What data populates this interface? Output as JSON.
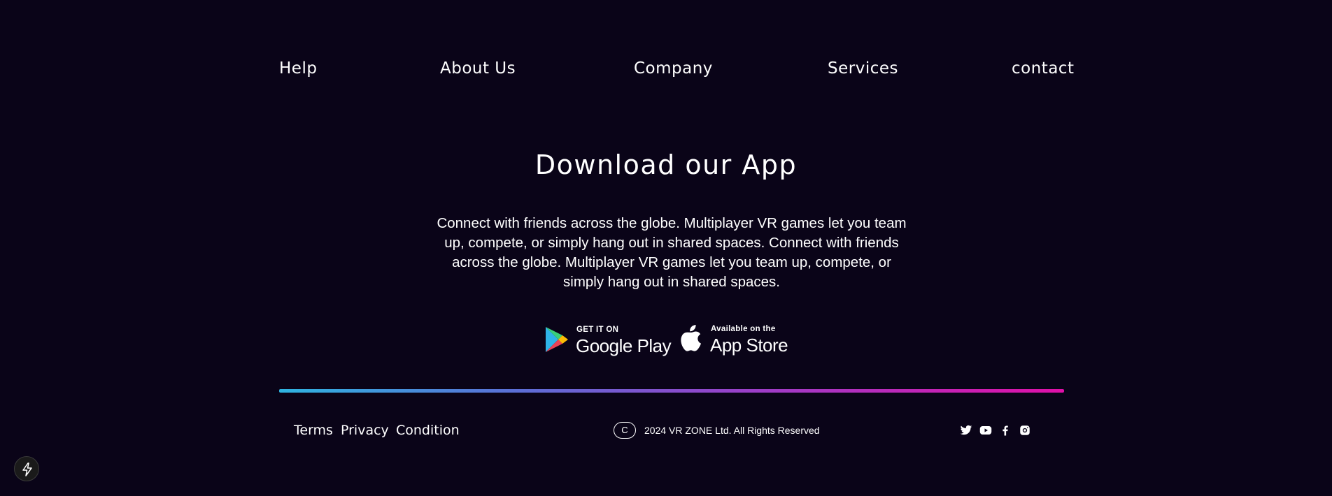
{
  "nav": {
    "items": [
      {
        "label": "Help"
      },
      {
        "label": "About Us"
      },
      {
        "label": "Company"
      },
      {
        "label": "Services"
      },
      {
        "label": "contact"
      }
    ]
  },
  "download": {
    "title": "Download our App",
    "description": "Connect with friends across the globe. Multiplayer VR games let you team up, compete, or simply hang out in shared spaces. Connect with friends across the globe. Multiplayer VR games let you team up, compete, or simply hang out in shared spaces.",
    "google_play": {
      "small": "GET IT ON",
      "big": "Google Play",
      "icon": "google-play-icon"
    },
    "app_store": {
      "small": "Available on the",
      "big": "App Store",
      "icon": "apple-icon"
    }
  },
  "footer": {
    "divider_gradient": [
      "#2fb4e0",
      "#9b3fc8",
      "#e010a8"
    ],
    "legal_links": [
      {
        "label": "Terms"
      },
      {
        "label": "Privacy"
      },
      {
        "label": "Condition"
      }
    ],
    "copyright_badge": "C",
    "copyright_text": "2024 VR ZONE Ltd. All Rights Reserved",
    "social": [
      "twitter-icon",
      "youtube-icon",
      "facebook-icon",
      "instagram-icon"
    ]
  },
  "floating_button": {
    "icon": "lightning-bolt-icon"
  },
  "colors": {
    "background": "#0a0418",
    "text": "#ffffff"
  }
}
